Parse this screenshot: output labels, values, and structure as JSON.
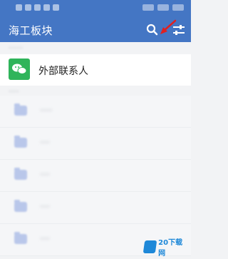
{
  "header": {
    "title": "海工板块",
    "search_icon": "search-icon",
    "filter_icon": "filter-icon"
  },
  "external_contacts": {
    "label": "外部联系人",
    "icon": "wechat-icon",
    "color": "#2fb45a"
  },
  "groups": [
    {
      "label": "·····"
    },
    {
      "label": "····"
    },
    {
      "label": "····"
    },
    {
      "label": "····"
    },
    {
      "label": "····"
    }
  ],
  "watermark": {
    "text": "20下载网"
  },
  "colors": {
    "header": "#4476c4",
    "arrow": "#e02020",
    "folder": "#b9c7ea"
  }
}
